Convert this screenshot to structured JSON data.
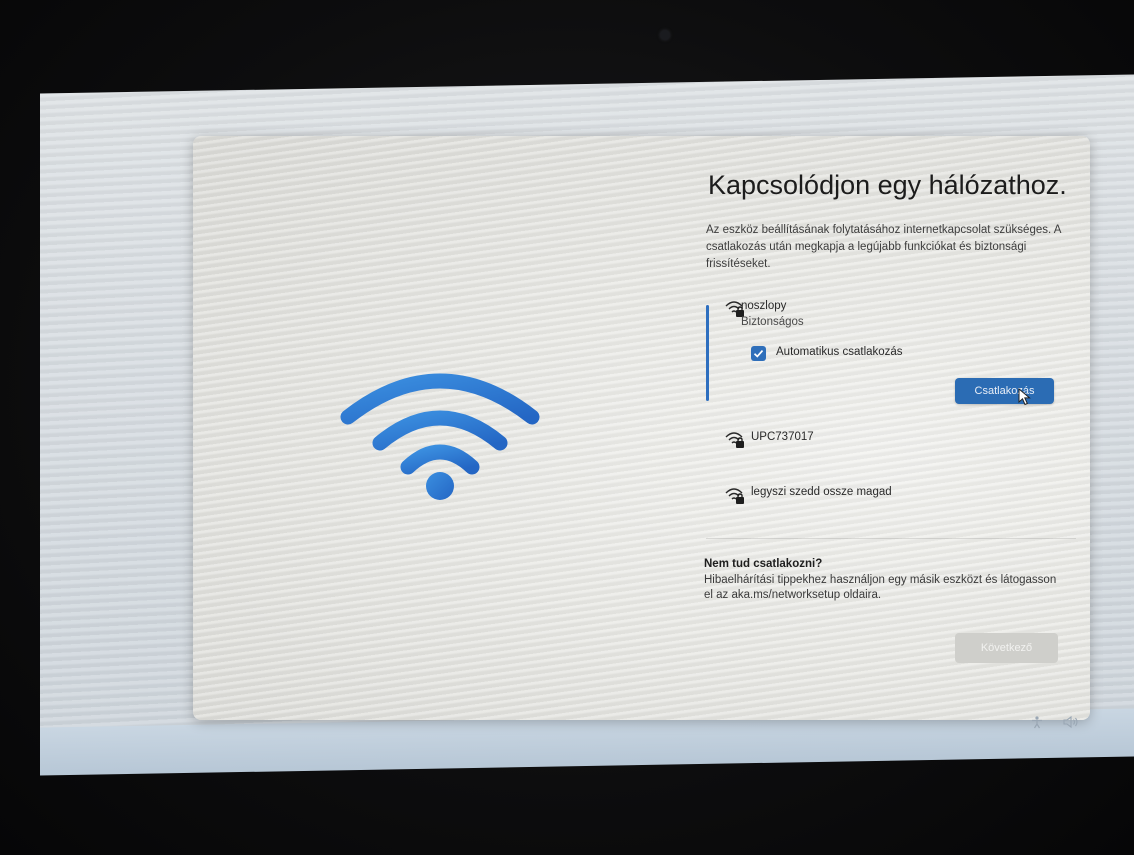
{
  "page": {
    "title": "Kapcsolódjon egy hálózathoz.",
    "subtitle": "Az eszköz beállításának folytatásához internetkapcsolat szükséges. A csatlakozás után megkapja a legújabb funkciókat és biztonsági frissítéseket."
  },
  "networks": [
    {
      "name": "noszlopy",
      "status": "Biztonságos",
      "icon": "wifi-locked-icon"
    },
    {
      "name": "UPC737017",
      "icon": "wifi-locked-icon"
    },
    {
      "name": "legyszi szedd ossze magad",
      "icon": "wifi-locked-icon"
    }
  ],
  "selected_network": {
    "auto_connect_label": "Automatikus csatlakozás",
    "auto_connect_checked": true,
    "connect_button": "Csatlakozás"
  },
  "help": {
    "title": "Nem tud csatlakozni?",
    "text": "Hibaelhárítási tippekhez használjon egy másik eszközt és látogasson el az aka.ms/networksetup oldaira."
  },
  "footer": {
    "next_button": "Következő"
  },
  "colors": {
    "accent": "#2b6cb4",
    "wifi_hero": "#2e7fd6"
  }
}
